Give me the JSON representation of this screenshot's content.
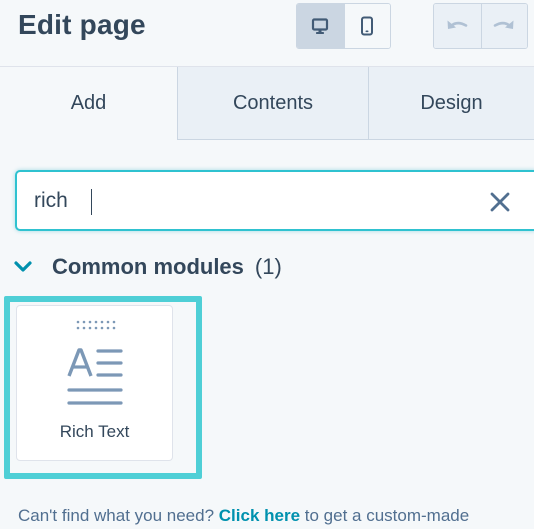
{
  "header": {
    "title": "Edit page",
    "device_toggle": [
      {
        "name": "desktop-view",
        "icon": "desktop-icon",
        "active": true
      },
      {
        "name": "mobile-view",
        "icon": "mobile-icon",
        "active": false
      }
    ],
    "history": [
      {
        "name": "undo",
        "icon": "undo-icon",
        "disabled": true
      },
      {
        "name": "redo",
        "icon": "redo-icon",
        "disabled": true
      }
    ]
  },
  "tabs": [
    {
      "label": "Add",
      "active": true
    },
    {
      "label": "Contents",
      "active": false
    },
    {
      "label": "Design",
      "active": false
    }
  ],
  "search": {
    "value": "rich",
    "clear_icon": "close-icon"
  },
  "section": {
    "title": "Common modules",
    "count": "(1)",
    "expanded": true
  },
  "modules": [
    {
      "label": "Rich Text",
      "icon": "rich-text-icon",
      "highlighted": true
    }
  ],
  "help": {
    "prefix": "Can't find what you need? ",
    "link": "Click here",
    "suffix": " to get a custom-made"
  },
  "colors": {
    "accent": "#2fc2d0",
    "highlight": "#4fcfd6",
    "text": "#33475b",
    "link": "#0091ae"
  }
}
